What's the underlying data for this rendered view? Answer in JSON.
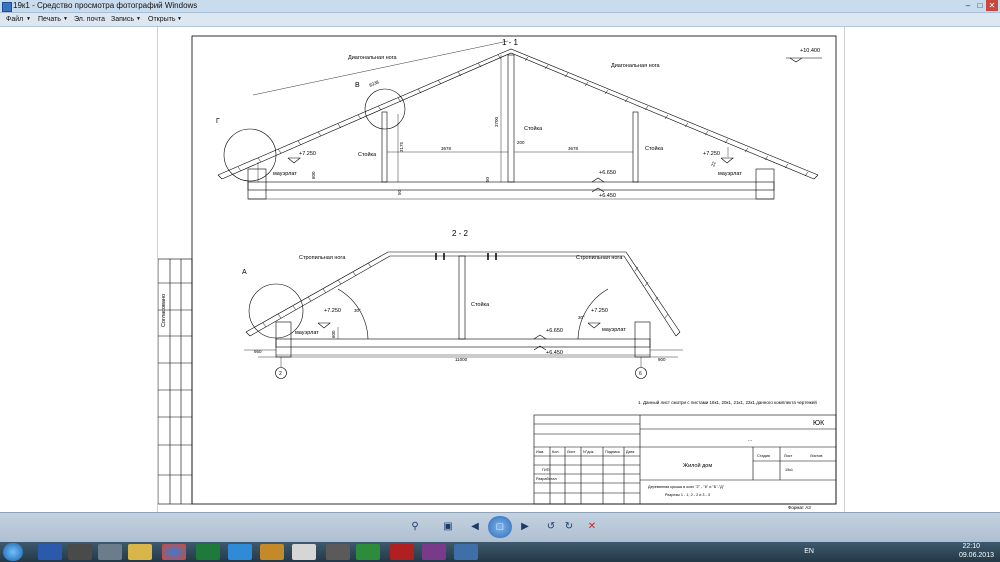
{
  "window": {
    "title": "19к1 - Средство просмотра фотографий Windows"
  },
  "menu": {
    "file": "Файл",
    "print": "Печать",
    "email": "Эл. почта",
    "burn": "Запись",
    "open": "Открыть"
  },
  "drawing": {
    "section1": {
      "title": "1 - 1",
      "diag_rafter_left": "Диагональная нога",
      "diag_rafter_right": "Диагональная нога",
      "node_v": "В",
      "node_g": "Г",
      "length_label": "8338",
      "post_label_center": "Стойка",
      "post_label_left": "Стойка",
      "post_label_right": "Стойка",
      "elev_top": "+10.400",
      "elev_left": "+7.250",
      "elev_right": "+7.250",
      "elev_mid1": "+6.650",
      "elev_mid2": "+6.450",
      "mauerlat_left": "мауэрлат",
      "mauerlat_right": "мауэрлат",
      "dim_span_left": "3678",
      "dim_span_right": "3678",
      "dim_center": "200",
      "dim_height": "3700",
      "dim_left_post": "3175",
      "dim_600": "600",
      "dim_50": "50",
      "dim_50b": "50",
      "dim_right_angle": "22"
    },
    "section2": {
      "title": "2 - 2",
      "rafter_left": "Стропильная нога",
      "rafter_right": "Стропильная нога",
      "node_a": "А",
      "post_label": "Стойка",
      "elev_left": "+7.250",
      "elev_right": "+7.250",
      "elev_mid1": "+6.650",
      "elev_mid2": "+6.450",
      "mauerlat_left": "мауэрлат",
      "mauerlat_right": "мауэрлат",
      "angle_left": "30°",
      "angle_right": "30°",
      "dim_600": "600",
      "dim_left": "950",
      "dim_span": "11000",
      "dim_right": "900",
      "axis_left": "2",
      "axis_right": "6"
    },
    "agreed": "Согласовано",
    "note": "1. Данный лист смотри с листами   18к1, 20к1, 21к1, 22к1 данного комплекта чертежей",
    "stamp": {
      "code": "ЮК",
      "dots": "...",
      "hdr_izm": "Изм.",
      "hdr_kol": "Кол.",
      "hdr_list": "Лист",
      "hdr_ndok": "N°док.",
      "hdr_podp": "Подпись",
      "hdr_data": "Дата",
      "gip": "ГИП",
      "razrab": "Разработал",
      "object": "Жилой дом",
      "stage": "Стадия",
      "sheet": "Лист",
      "sheets": "Листов",
      "sheet_no": "19к1",
      "desc1": "Деревянная крыша  в осях  \"2\" - \"6\" и \"Б\"-\"Д\"",
      "desc2": "Разрезы 1 - 1, 2 - 2 и 3 - 3",
      "format": "Формат А3"
    }
  },
  "taskbar": {
    "lang": "EN",
    "time": "22:10",
    "date": "09.06.2013"
  }
}
